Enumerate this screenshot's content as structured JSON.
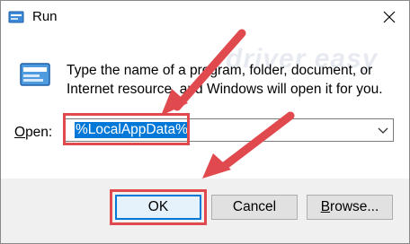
{
  "window": {
    "title": "Run",
    "close_icon": "close-icon"
  },
  "dialog": {
    "icon": "run-icon",
    "description": "Type the name of a program, folder, document, or Internet resource, and Windows will open it for you.",
    "watermark": "driver easy",
    "open_label_accel": "O",
    "open_label_rest": "pen:",
    "open_value": "%LocalAppData%"
  },
  "buttons": {
    "ok": "OK",
    "cancel": "Cancel",
    "browse_accel": "B",
    "browse_rest": "rowse..."
  },
  "colors": {
    "highlight_red": "#e04a4f",
    "selection_blue": "#0078d7"
  }
}
